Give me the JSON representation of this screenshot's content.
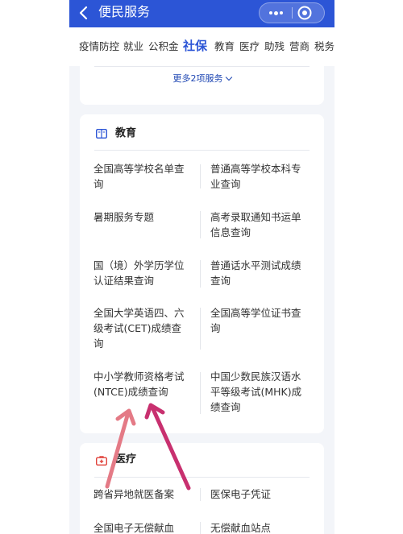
{
  "app": {
    "title": "便民服务",
    "back_icon": "chevron-left-icon",
    "more_icon": "more-dots-icon",
    "close_icon": "target-close-icon",
    "accent_color": "#2c55d6"
  },
  "tabs": [
    {
      "label": "疫情防控",
      "active": false
    },
    {
      "label": "就业",
      "active": false
    },
    {
      "label": "公积金",
      "active": false
    },
    {
      "label": "社保",
      "active": true
    },
    {
      "label": "教育",
      "active": false
    },
    {
      "label": "医疗",
      "active": false
    },
    {
      "label": "助残",
      "active": false
    },
    {
      "label": "营商",
      "active": false
    },
    {
      "label": "税务",
      "active": false
    }
  ],
  "social_security": {
    "more_label": "更多2项服务"
  },
  "education": {
    "title": "教育",
    "icon": "book-icon",
    "items": [
      [
        "全国高等学校名单查询",
        "普通高等学校本科专业查询"
      ],
      [
        "暑期服务专题",
        "高考录取通知书运单信息查询"
      ],
      [
        "国（境）外学历学位认证结果查询",
        "普通话水平测试成绩查询"
      ],
      [
        "全国大学英语四、六级考试(CET)成绩查询",
        "全国高等学位证书查询"
      ],
      [
        "中小学教师资格考试(NTCE)成绩查询",
        "中国少数民族汉语水平等级考试(MHK)成绩查询"
      ]
    ]
  },
  "medical": {
    "title": "医疗",
    "icon": "medical-kit-icon",
    "items": [
      [
        "跨省异地就医备案",
        "医保电子凭证"
      ],
      [
        "全国电子无偿献血",
        "无偿献血站点"
      ]
    ]
  },
  "annotation": {
    "arrow_colors": [
      "#e47a86",
      "#c8306f"
    ]
  }
}
